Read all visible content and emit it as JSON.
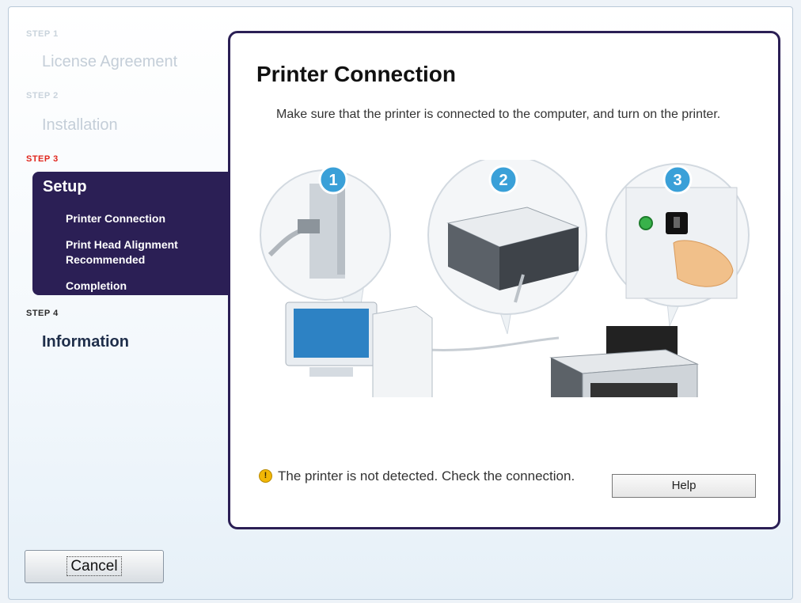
{
  "sidebar": {
    "steps": [
      {
        "label": "STEP 1",
        "title": "License Agreement"
      },
      {
        "label": "STEP 2",
        "title": "Installation"
      },
      {
        "label": "STEP 3",
        "title": "Setup",
        "subitems": [
          "Printer Connection",
          "Print Head Alignment Recommended",
          "Completion"
        ]
      },
      {
        "label": "STEP 4",
        "title": "Information"
      }
    ]
  },
  "panel": {
    "title": "Printer Connection",
    "description": "Make sure that the printer is connected to the computer, and turn on the printer.",
    "steps_numbers": [
      "1",
      "2",
      "3"
    ],
    "warning_text": "The printer is not detected. Check the connection.",
    "help_label": "Help"
  },
  "footer": {
    "cancel_label": "Cancel"
  },
  "colors": {
    "accent": "#2b1f55",
    "active_step": "#e0261d",
    "badge": "#3aa0d8"
  },
  "icons": {
    "warning": "warning-icon"
  }
}
